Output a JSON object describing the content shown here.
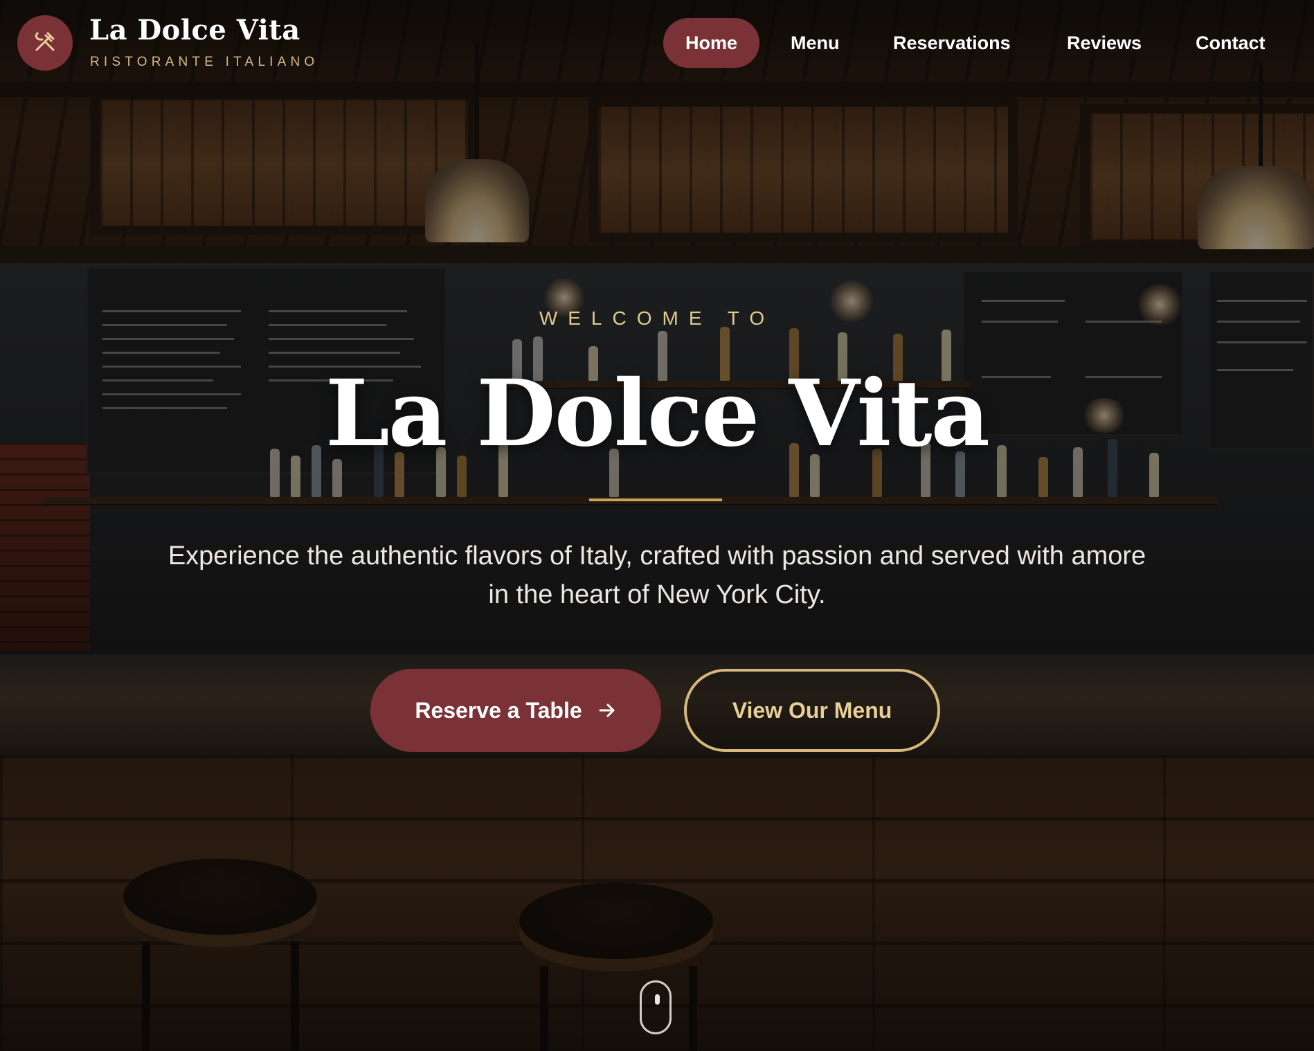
{
  "brand": {
    "name": "La Dolce Vita",
    "subtitle": "RISTORANTE ITALIANO",
    "logo_icon": "fork-knife-icon",
    "accent_color": "#7b3237",
    "gold_color": "#d6b77c"
  },
  "nav": {
    "items": [
      {
        "label": "Home",
        "active": true
      },
      {
        "label": "Menu",
        "active": false
      },
      {
        "label": "Reservations",
        "active": false
      },
      {
        "label": "Reviews",
        "active": false
      },
      {
        "label": "Contact",
        "active": false
      }
    ]
  },
  "hero": {
    "kicker": "WELCOME TO",
    "title": "La Dolce Vita",
    "description": "Experience the authentic flavors of Italy, crafted with passion and served with amore in the heart of New York City.",
    "primary_button": {
      "label": "Reserve a Table",
      "icon": "arrow-right-icon"
    },
    "secondary_button": {
      "label": "View Our Menu"
    }
  },
  "scroll_indicator": {
    "icon": "mouse-scroll-icon"
  }
}
